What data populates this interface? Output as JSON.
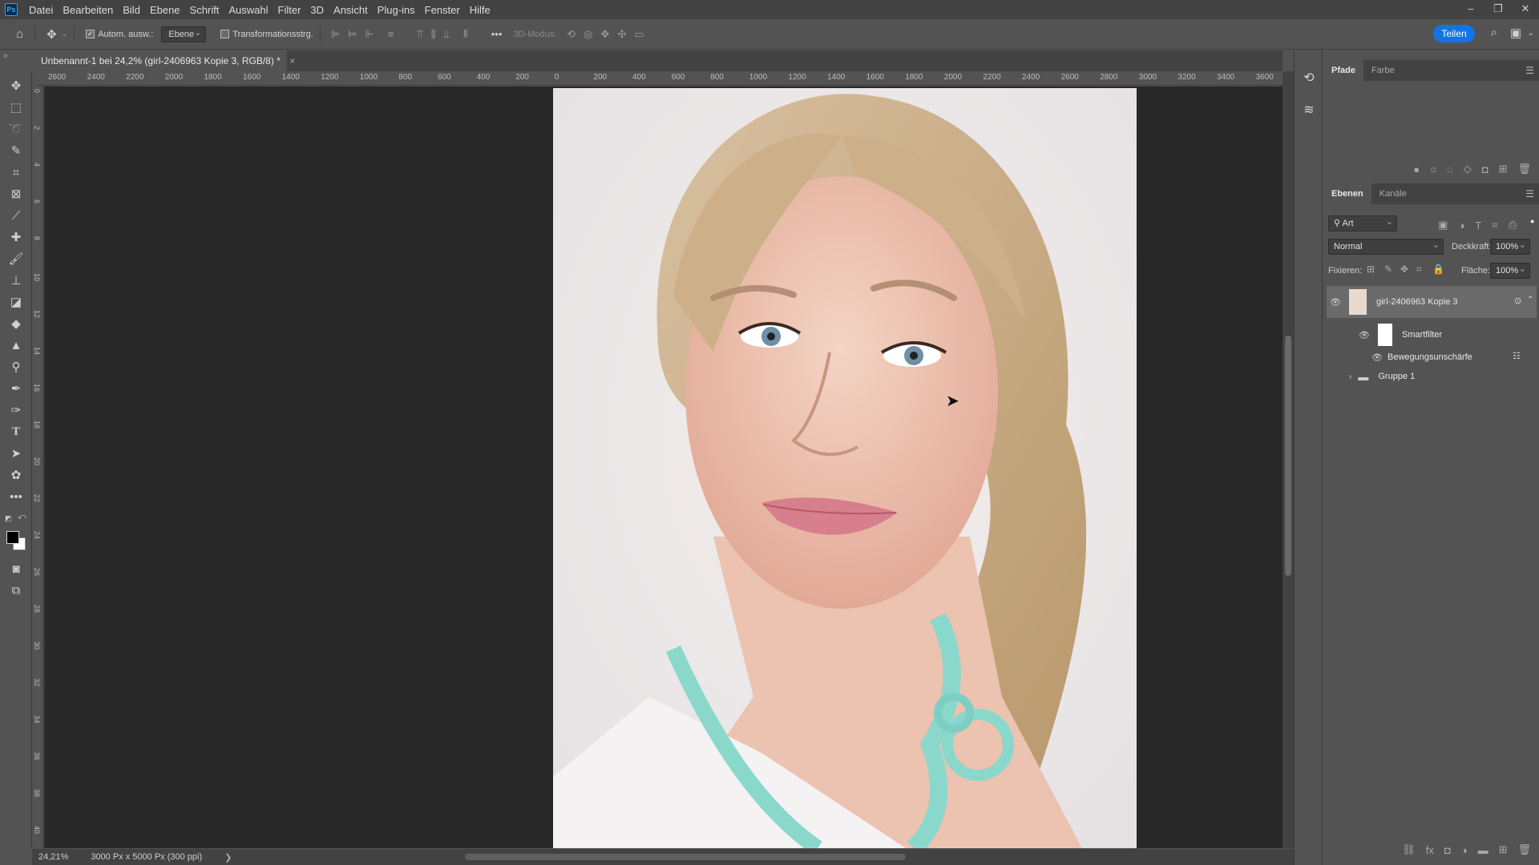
{
  "app": {
    "logo_text": "Ps",
    "menu": [
      "Datei",
      "Bearbeiten",
      "Bild",
      "Ebene",
      "Schrift",
      "Auswahl",
      "Filter",
      "3D",
      "Ansicht",
      "Plug-ins",
      "Fenster",
      "Hilfe"
    ],
    "window_controls": [
      "–",
      "❐",
      "✕"
    ]
  },
  "options_bar": {
    "auto_select_label": "Autom. ausw.:",
    "auto_select_checked": true,
    "auto_select_target": "Ebene",
    "transform_controls_label": "Transformationsstrg.",
    "transform_controls_checked": false,
    "more_label": "•••",
    "mode_3d_label": "3D-Modus:",
    "share_label": "Teilen"
  },
  "document": {
    "tab_title": "Unbenannt-1 bei 24,2% (girl-2406963 Kopie 3, RGB/8) *",
    "close_label": "×"
  },
  "rulers": {
    "horizontal": [
      "2600",
      "2400",
      "2200",
      "2000",
      "1800",
      "1600",
      "1400",
      "1200",
      "1000",
      "800",
      "600",
      "400",
      "200",
      "0",
      "200",
      "400",
      "600",
      "800",
      "1000",
      "1200",
      "1400",
      "1600",
      "1800",
      "2000",
      "2200",
      "2400",
      "2600",
      "2800",
      "3000",
      "3200",
      "3400",
      "3600"
    ],
    "vertical": [
      "0",
      "2",
      "4",
      "6",
      "8",
      "10",
      "12",
      "14",
      "16",
      "18",
      "20",
      "22",
      "24",
      "26",
      "28",
      "30",
      "32",
      "34",
      "36",
      "38",
      "40",
      "42"
    ]
  },
  "status_bar": {
    "zoom": "24,21%",
    "doc_size": "3000 Px x 5000 Px (300 ppi)",
    "arrow": "❯"
  },
  "panels": {
    "top_tabs": [
      "Pfade",
      "Farbe"
    ],
    "layers_tabs": [
      "Ebenen",
      "Kanäle"
    ],
    "filter_kind": "Art",
    "blend_mode": "Normal",
    "opacity_label": "Deckkraft:",
    "opacity_value": "100%",
    "lock_label": "Fixieren:",
    "fill_label": "Fläche:",
    "fill_value": "100%",
    "layers": [
      {
        "name": "girl-2406963 Kopie 3",
        "selected": true
      },
      {
        "name": "Smartfilter"
      },
      {
        "name": "Bewegungsunschärfe"
      },
      {
        "name": "Gruppe 1"
      }
    ]
  },
  "colors": {
    "accent": "#1473e6",
    "foreground": "#000000",
    "background": "#ffffff"
  }
}
